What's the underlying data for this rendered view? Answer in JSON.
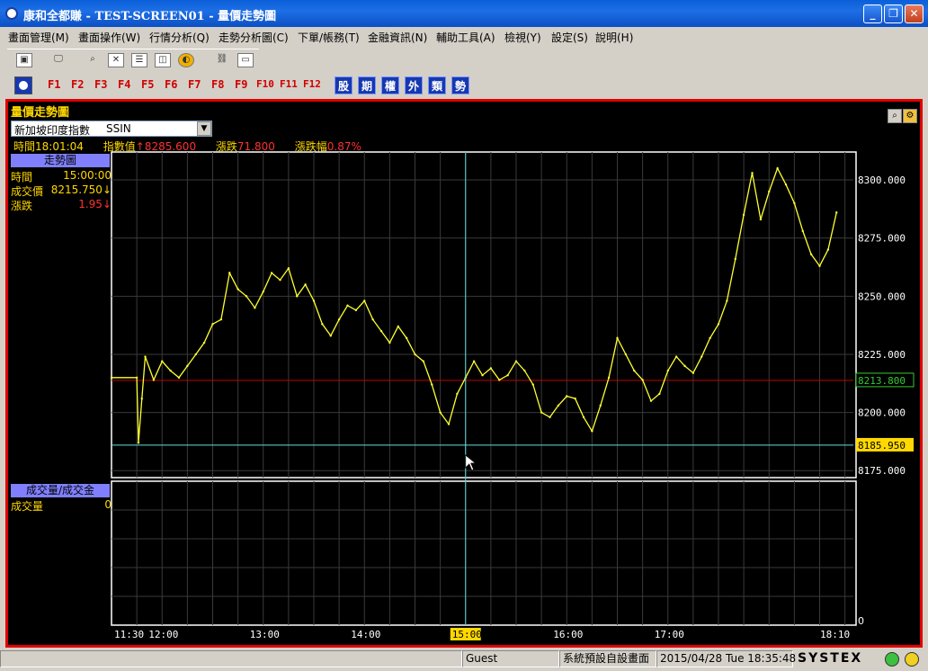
{
  "window": {
    "title": "康和全都賺 - TEST-SCREEN01 - 量價走勢圖"
  },
  "menu": [
    "畫面管理(M)",
    "畫面操作(W)",
    "行情分析(Q)",
    "走勢分析圖(C)",
    "下單/帳務(T)",
    "金融資訊(N)",
    "輔助工具(A)",
    "檢視(Y)",
    "設定(S)",
    "說明(H)"
  ],
  "toolbar": {
    "fkeys": [
      "F1",
      "F2",
      "F3",
      "F4",
      "F5",
      "F6",
      "F7",
      "F8",
      "F9",
      "F10",
      "F11",
      "F12"
    ],
    "category_keys": [
      "股",
      "期",
      "權",
      "外",
      "類",
      "勢"
    ]
  },
  "panel": {
    "title": "量價走勢圖",
    "selector": {
      "name": "新加坡印度指數",
      "code": "SSIN"
    },
    "info": {
      "time_label": "時間",
      "time": "18:01:04",
      "index_label": "指數值",
      "index": "↑8285.600",
      "change_label": "漲跌",
      "change": "71.800",
      "pct_label": "漲跌幅",
      "pct": "0.87%"
    },
    "trend_header": "走勢圖",
    "cursor_info": [
      {
        "label": "時間",
        "value": "15:00:00"
      },
      {
        "label": "成交價",
        "value": "8215.750↓"
      },
      {
        "label": "漲跌",
        "value": "1.95↓"
      }
    ],
    "volume_header": "成交量/成交金",
    "volume_info": {
      "label": "成交量",
      "value": "0"
    }
  },
  "chart_data": {
    "type": "line",
    "x_ticks": [
      "11:30",
      "12:00",
      "13:00",
      "14:00",
      "15:00",
      "16:00",
      "17:00",
      "18:10"
    ],
    "y_ticks": [
      "8300.000",
      "8275.000",
      "8250.000",
      "8225.000",
      "8200.000",
      "8175.000"
    ],
    "reference_label": "8213.800",
    "reference_value": 8213.8,
    "low_label": "8185.950",
    "low_value": 8185.95,
    "cursor_x_label": "15:00",
    "volume_y_label": "0",
    "ylim": [
      8172,
      8312
    ],
    "series": [
      {
        "values": [
          [
            "11:30",
            8215
          ],
          [
            "11:45",
            8215
          ],
          [
            "11:46",
            8187
          ],
          [
            "11:48",
            8206
          ],
          [
            "11:50",
            8224
          ],
          [
            "11:55",
            8214
          ],
          [
            "12:00",
            8222
          ],
          [
            "12:05",
            8218
          ],
          [
            "12:10",
            8215
          ],
          [
            "12:15",
            8220
          ],
          [
            "12:20",
            8225
          ],
          [
            "12:25",
            8230
          ],
          [
            "12:30",
            8238
          ],
          [
            "12:35",
            8240
          ],
          [
            "12:40",
            8260
          ],
          [
            "12:45",
            8253
          ],
          [
            "12:50",
            8250
          ],
          [
            "12:55",
            8245
          ],
          [
            "13:00",
            8252
          ],
          [
            "13:05",
            8260
          ],
          [
            "13:10",
            8257
          ],
          [
            "13:15",
            8262
          ],
          [
            "13:20",
            8250
          ],
          [
            "13:25",
            8255
          ],
          [
            "13:30",
            8248
          ],
          [
            "13:35",
            8238
          ],
          [
            "13:40",
            8233
          ],
          [
            "13:45",
            8240
          ],
          [
            "13:50",
            8246
          ],
          [
            "13:55",
            8244
          ],
          [
            "14:00",
            8248
          ],
          [
            "14:05",
            8240
          ],
          [
            "14:10",
            8235
          ],
          [
            "14:15",
            8230
          ],
          [
            "14:20",
            8237
          ],
          [
            "14:25",
            8232
          ],
          [
            "14:30",
            8225
          ],
          [
            "14:35",
            8222
          ],
          [
            "14:40",
            8212
          ],
          [
            "14:45",
            8200
          ],
          [
            "14:50",
            8195
          ],
          [
            "14:55",
            8208
          ],
          [
            "15:00",
            8215
          ],
          [
            "15:05",
            8222
          ],
          [
            "15:10",
            8216
          ],
          [
            "15:15",
            8219
          ],
          [
            "15:20",
            8214
          ],
          [
            "15:25",
            8216
          ],
          [
            "15:30",
            8222
          ],
          [
            "15:35",
            8218
          ],
          [
            "15:40",
            8212
          ],
          [
            "15:45",
            8200
          ],
          [
            "15:50",
            8198
          ],
          [
            "15:55",
            8203
          ],
          [
            "16:00",
            8207
          ],
          [
            "16:05",
            8206
          ],
          [
            "16:10",
            8198
          ],
          [
            "16:15",
            8192
          ],
          [
            "16:20",
            8203
          ],
          [
            "16:25",
            8215
          ],
          [
            "16:30",
            8232
          ],
          [
            "16:35",
            8225
          ],
          [
            "16:40",
            8218
          ],
          [
            "16:45",
            8214
          ],
          [
            "16:50",
            8205
          ],
          [
            "16:55",
            8208
          ],
          [
            "17:00",
            8218
          ],
          [
            "17:05",
            8224
          ],
          [
            "17:10",
            8220
          ],
          [
            "17:15",
            8217
          ],
          [
            "17:20",
            8224
          ],
          [
            "17:25",
            8232
          ],
          [
            "17:30",
            8238
          ],
          [
            "17:35",
            8248
          ],
          [
            "17:40",
            8266
          ],
          [
            "17:45",
            8285
          ],
          [
            "17:50",
            8303
          ],
          [
            "17:55",
            8283
          ],
          [
            "18:00",
            8295
          ],
          [
            "18:05",
            8305
          ],
          [
            "18:10",
            8298
          ],
          [
            "18:15",
            8290
          ],
          [
            "18:20",
            8278
          ],
          [
            "18:25",
            8268
          ],
          [
            "18:30",
            8263
          ],
          [
            "18:35",
            8270
          ],
          [
            "18:40",
            8286
          ]
        ]
      }
    ],
    "colors": {
      "line": "#ffff30",
      "grid": "#3a3a3a",
      "reference": "#c00000",
      "cursor": "#66dddd",
      "low_line": "#66dddd"
    }
  },
  "statusbar": {
    "user": "Guest",
    "screen": "系統預設自設畫面",
    "datetime": "2015/04/28 Tue 18:35:48",
    "brand": "SYSTEX"
  }
}
